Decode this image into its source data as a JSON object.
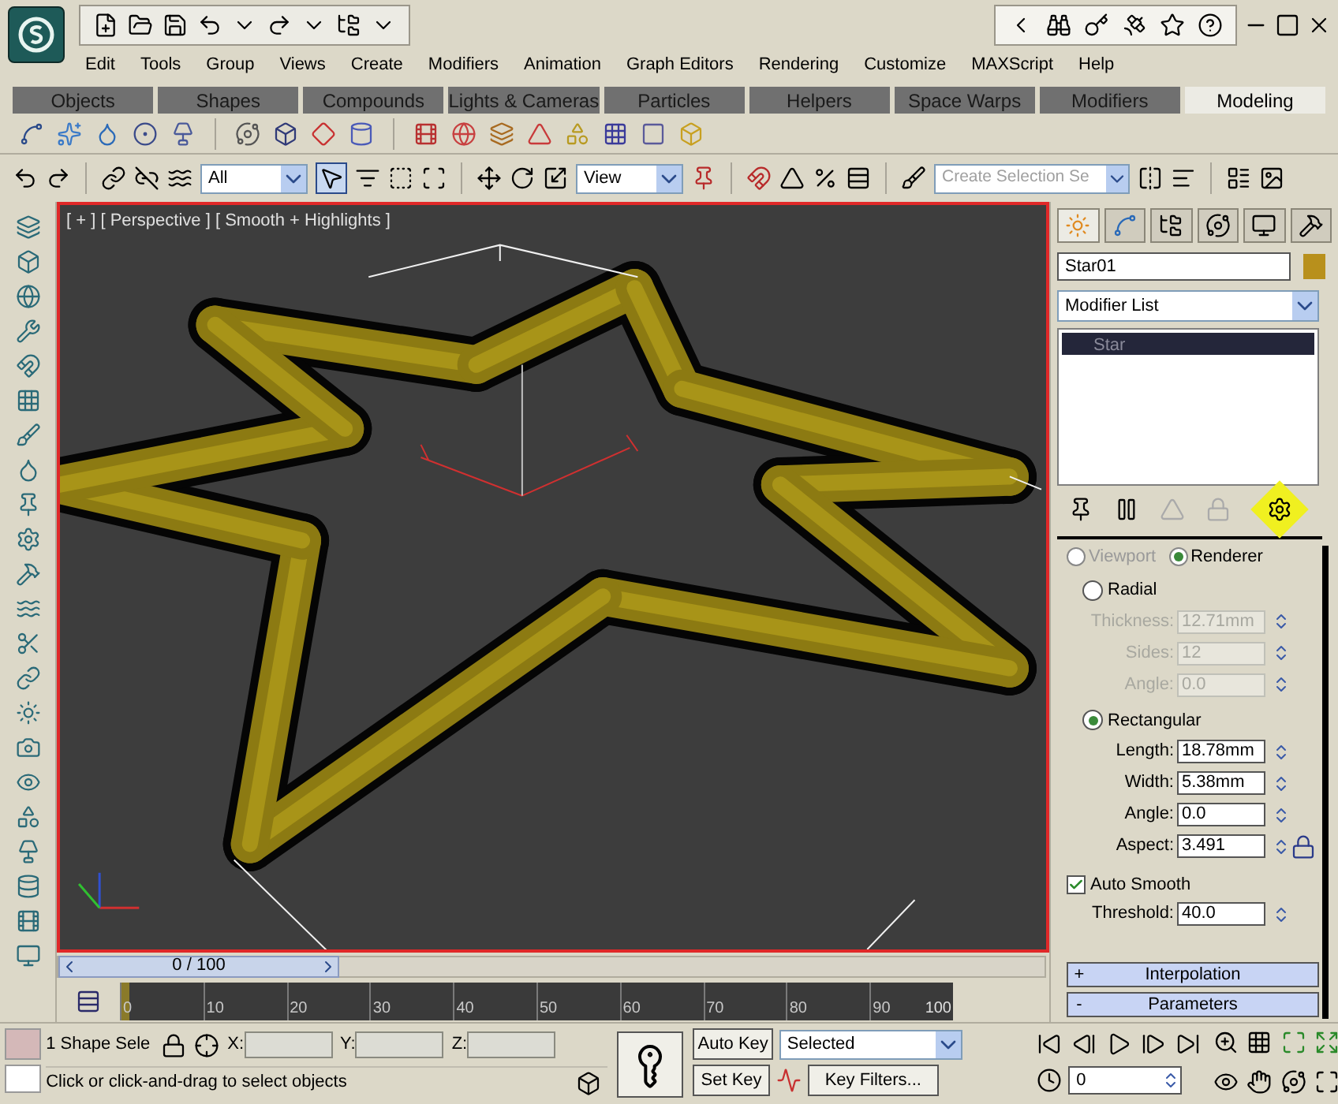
{
  "menu": [
    "Edit",
    "Tools",
    "Group",
    "Views",
    "Create",
    "Modifiers",
    "Animation",
    "Graph Editors",
    "Rendering",
    "Customize",
    "MAXScript",
    "Help"
  ],
  "ribbon_tabs": [
    {
      "label": "Objects",
      "selected": false
    },
    {
      "label": "Shapes",
      "selected": false
    },
    {
      "label": "Compounds",
      "selected": false
    },
    {
      "label": "Lights & Cameras",
      "selected": false
    },
    {
      "label": "Particles",
      "selected": false
    },
    {
      "label": "Helpers",
      "selected": false
    },
    {
      "label": "Space Warps",
      "selected": false
    },
    {
      "label": "Modifiers",
      "selected": false
    },
    {
      "label": "Modeling",
      "selected": true
    }
  ],
  "main_toolbar": {
    "selection_filter": "All",
    "reference_coordinate": "View",
    "named_selection": {
      "placeholder": "Create Selection Se"
    }
  },
  "viewport": {
    "label": "[ + ] [ Perspective ] [ Smooth + Highlights ]"
  },
  "command_panel": {
    "panel_tabs": [
      {
        "selected": true
      },
      {
        "selected": false
      },
      {
        "selected": false
      },
      {
        "selected": false
      },
      {
        "selected": false
      },
      {
        "selected": false
      }
    ],
    "object_name": "Star01",
    "modifier_list": "Modifier List",
    "stack": [
      {
        "label": "Star",
        "selected": true
      }
    ],
    "render_modes": [
      {
        "label": "Viewport",
        "selected": false
      },
      {
        "label": "Renderer",
        "selected": true
      }
    ],
    "profiles": [
      {
        "label": "Radial",
        "selected": false,
        "fields": [
          {
            "label": "Thickness:",
            "value": "12.71mm",
            "disabled": true,
            "lock": false
          },
          {
            "label": "Sides:",
            "value": "12",
            "disabled": true,
            "lock": false
          },
          {
            "label": "Angle:",
            "value": "0.0",
            "disabled": true,
            "lock": false
          }
        ]
      },
      {
        "label": "Rectangular",
        "selected": true,
        "fields": [
          {
            "label": "Length:",
            "value": "18.78mm",
            "disabled": false,
            "lock": false
          },
          {
            "label": "Width:",
            "value": "5.38mm",
            "disabled": false,
            "lock": false
          },
          {
            "label": "Angle:",
            "value": "0.0",
            "disabled": false,
            "lock": false
          },
          {
            "label": "Aspect:",
            "value": "3.491",
            "disabled": false,
            "lock": true
          }
        ]
      }
    ],
    "auto_smooth": {
      "label": "Auto Smooth",
      "checked": true
    },
    "threshold": {
      "label": "Threshold:",
      "value": "40.0"
    },
    "rollouts": [
      {
        "sign": "+",
        "label": "Interpolation"
      },
      {
        "sign": "-",
        "label": "Parameters"
      }
    ]
  },
  "time_slider": {
    "label": "0 / 100",
    "level": 0
  },
  "trackbar_labels": [
    "0",
    "10",
    "20",
    "30",
    "40",
    "50",
    "60",
    "70",
    "80",
    "90",
    "100"
  ],
  "status": {
    "selection": "1 Shape Sele",
    "coords": [
      "X:",
      "Y:",
      "Z:"
    ],
    "prompt": "Click or click-and-drag to select objects",
    "auto_key": "Auto Key",
    "set_key": "Set Key",
    "key_mode": "Selected",
    "key_filters": "Key Filters...",
    "frame": "0"
  }
}
